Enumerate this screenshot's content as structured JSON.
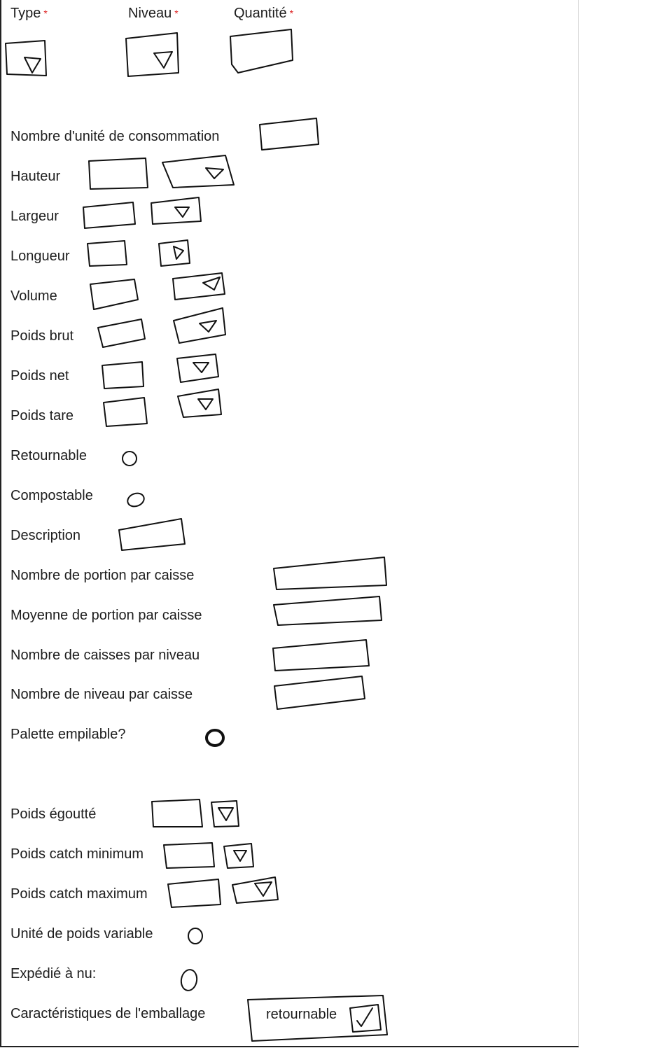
{
  "header": {
    "type_label": "Type",
    "niveau_label": "Niveau",
    "quantite_label": "Quantité",
    "required_mark": "*"
  },
  "fields": {
    "nombre_unite_consommation": "Nombre d'unité de consommation",
    "hauteur": "Hauteur",
    "largeur": "Largeur",
    "longueur": "Longueur",
    "volume": "Volume",
    "poids_brut": "Poids brut",
    "poids_net": "Poids net",
    "poids_tare": "Poids tare",
    "retournable": "Retournable",
    "compostable": "Compostable",
    "description": "Description",
    "nombre_portion_caisse": "Nombre de portion par caisse",
    "moyenne_portion_caisse": "Moyenne de portion par caisse",
    "nombre_caisses_niveau": "Nombre de caisses par niveau",
    "nombre_niveau_caisse": "Nombre de niveau par caisse",
    "palette_empilable": "Palette empilable?",
    "poids_egoutte": "Poids égoutté",
    "poids_catch_minimum": "Poids catch minimum",
    "poids_catch_maximum": "Poids catch maximum",
    "unite_poids_variable": "Unité de poids variable",
    "expedie_a_nu": "Expédié à nu:",
    "caracteristiques_emballage": "Caractéristiques de l'emballage"
  },
  "emballage": {
    "option_label": "retournable",
    "checked": true
  }
}
